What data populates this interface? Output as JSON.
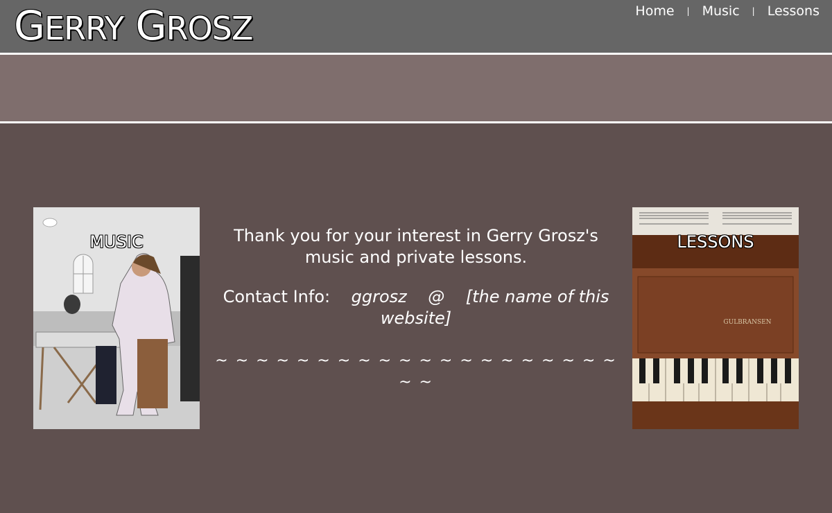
{
  "header": {
    "title_initial_1": "G",
    "title_rest_1": "ERRY",
    "title_initial_2": "G",
    "title_rest_2": "ROSZ"
  },
  "nav": {
    "items": [
      {
        "label": "Home"
      },
      {
        "label": "Music"
      },
      {
        "label": "Lessons"
      }
    ],
    "separator": "|"
  },
  "cards": {
    "music": {
      "label": "MUSIC"
    },
    "lessons": {
      "label": "LESSONS"
    }
  },
  "main": {
    "thanks_line_1": "Thank you for your interest in Gerry Grosz's",
    "thanks_line_2": "music and private lessons.",
    "contact_label": "Contact Info:",
    "contact_user": "ggrosz",
    "contact_at": "@",
    "contact_domain_1": "[the name of this",
    "contact_domain_2": "website]",
    "divider": "~ ~ ~ ~ ~ ~ ~ ~ ~ ~ ~ ~ ~ ~ ~ ~ ~ ~ ~ ~ ~ ~"
  },
  "colors": {
    "header_bg": "#666666",
    "band_bg": "#7f6e6d",
    "page_bg": "#5f504f"
  }
}
